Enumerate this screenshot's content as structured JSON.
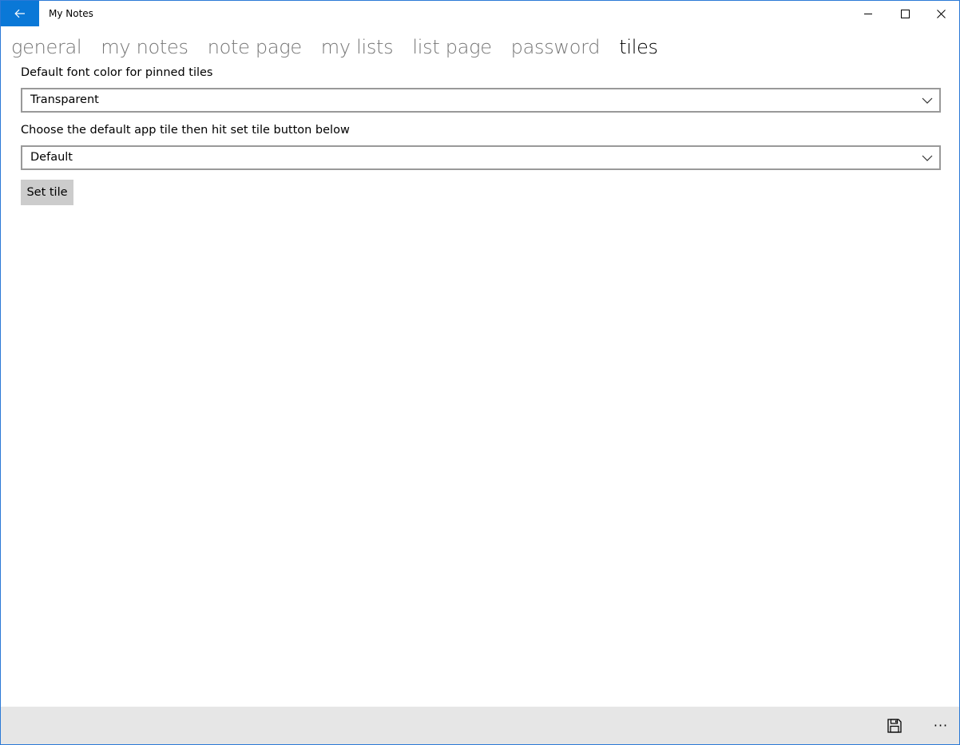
{
  "window": {
    "title": "My Notes",
    "accent_color": "#0a78d7",
    "border_color": "#2b79d6"
  },
  "titlebar": {
    "back_icon": "arrow-left-icon",
    "minimize_icon": "minimize-icon",
    "maximize_icon": "maximize-icon",
    "close_icon": "close-icon"
  },
  "pivot": {
    "tabs": [
      {
        "label": "general",
        "active": false
      },
      {
        "label": "my notes",
        "active": false
      },
      {
        "label": "note page",
        "active": false
      },
      {
        "label": "my lists",
        "active": false
      },
      {
        "label": "list page",
        "active": false
      },
      {
        "label": "password",
        "active": false
      },
      {
        "label": "tiles",
        "active": true
      }
    ]
  },
  "content": {
    "font_color_label": "Default font color for pinned tiles",
    "font_color_value": "Transparent",
    "app_tile_label": "Choose the default app tile then hit set tile button below",
    "app_tile_value": "Default",
    "set_tile_label": "Set tile"
  },
  "appbar": {
    "save_icon": "save-icon",
    "more_icon": "more-icon",
    "more_glyph": "···"
  }
}
